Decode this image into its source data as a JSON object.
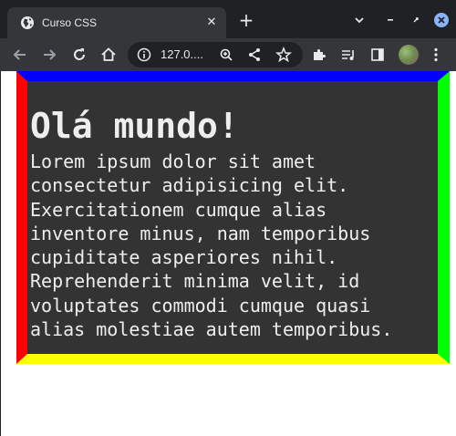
{
  "browser": {
    "tab": {
      "title": "Curso CSS",
      "favicon": "globe-icon",
      "close_icon": "close-icon"
    },
    "new_tab_icon": "plus-icon",
    "window_controls": [
      "chevron-down-icon",
      "minimize-icon",
      "restore-icon",
      "close-circle-icon"
    ],
    "address_bar": {
      "url": "127.0....",
      "site_info_icon": "info-icon"
    },
    "toolbar_icons": [
      "back-arrow-icon",
      "forward-arrow-icon",
      "reload-icon",
      "home-icon",
      "zoom-icon",
      "share-icon",
      "bookmark-star-icon",
      "extensions-puzzle-icon",
      "media-queue-icon",
      "side-panel-icon",
      "profile-avatar",
      "kebab-menu-icon"
    ],
    "colors": {
      "tabstrip": "#202124",
      "toolbar": "#35363a",
      "omnibox": "#202124"
    }
  },
  "page": {
    "heading": "Olá mundo!",
    "paragraph_lines": [
      "Lorem ipsum dolor sit amet",
      "consectetur adipisicing elit.",
      "Exercitationem cumque alias",
      "inventore minus, nam temporibus",
      "cupiditate asperiores nihil.",
      "Reprehenderit minima velit, id",
      "voluptates commodi cumque quasi",
      "alias molestiae autem temporibus."
    ],
    "colors": {
      "background": "#333333",
      "text": "#eeeeee",
      "border_top": "#0000ff",
      "border_right": "#00ff00",
      "border_bottom": "#ffff00",
      "border_left": "#ff0000"
    }
  }
}
